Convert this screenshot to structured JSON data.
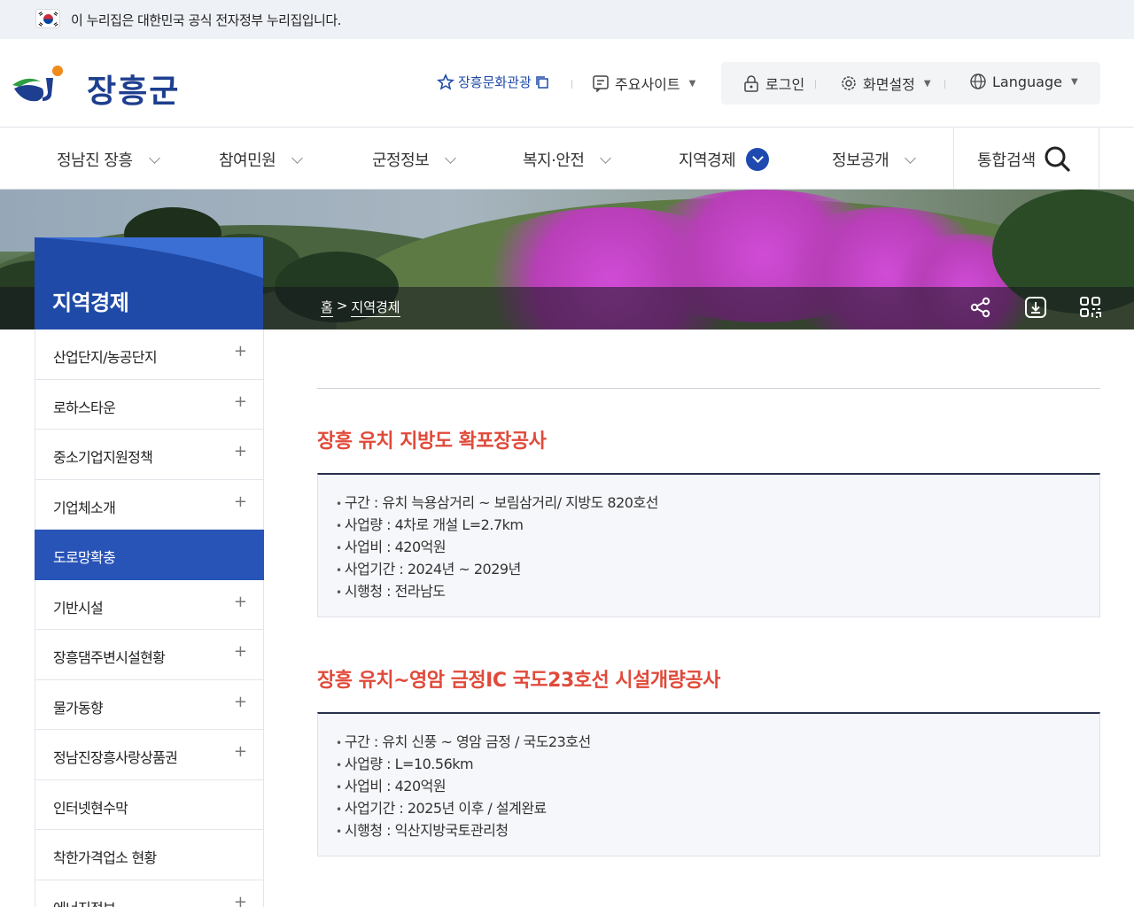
{
  "gov_banner": {
    "text": "이 누리집은 대한민국 공식 전자정부 누리집입니다."
  },
  "header": {
    "logo_text": "장흥군",
    "culture_link": "장흥문화관광",
    "main_sites": "주요사이트",
    "login": "로그인",
    "screen_settings": "화면설정",
    "language": "Language"
  },
  "gnb": {
    "items": [
      {
        "label": "정남진 장흥"
      },
      {
        "label": "참여민원"
      },
      {
        "label": "군정정보"
      },
      {
        "label": "복지·안전"
      },
      {
        "label": "지역경제"
      },
      {
        "label": "정보공개"
      }
    ],
    "search_label": "통합검색"
  },
  "visual": {
    "section_title": "지역경제",
    "breadcrumb_home": "홈",
    "breadcrumb_sep": ">",
    "breadcrumb_current": "지역경제"
  },
  "lnb": {
    "items": [
      {
        "label": "산업단지/농공단지",
        "plus": "+"
      },
      {
        "label": "로하스타운",
        "plus": "+"
      },
      {
        "label": "중소기업지원정책",
        "plus": "+"
      },
      {
        "label": "기업체소개",
        "plus": "+"
      },
      {
        "label": "도로망확충",
        "plus": ""
      },
      {
        "label": "기반시설",
        "plus": "+"
      },
      {
        "label": "장흥댐주변시설현황",
        "plus": "+"
      },
      {
        "label": "물가동향",
        "plus": "+"
      },
      {
        "label": "정남진장흥사랑상품권",
        "plus": "+"
      },
      {
        "label": "인터넷현수막",
        "plus": ""
      },
      {
        "label": "착한가격업소 현황",
        "plus": ""
      },
      {
        "label": "에너지정보",
        "plus": "+"
      }
    ]
  },
  "content": {
    "sections": [
      {
        "title": "장흥 유치 지방도 확포장공사",
        "rows": [
          "구간 : 유치 늑용삼거리 ~ 보림삼거리/ 지방도 820호선",
          "사업량 : 4차로 개설 L=2.7km",
          "사업비 : 420억원",
          "사업기간 : 2024년 ~ 2029년",
          "시행청 : 전라남도"
        ]
      },
      {
        "title": "장흥 유치~영암 금정IC 국도23호선 시설개량공사",
        "rows": [
          "구간 : 유치 신풍 ~ 영암 금정 / 국도23호선",
          "사업량 : L=10.56km",
          "사업비 : 420억원",
          "사업기간 : 2025년 이후 / 설계완료",
          "시행청 : 익산지방국토관리청"
        ]
      }
    ]
  },
  "colors": {
    "brand_blue": "#1f4aa8",
    "accent_red": "#e04a3a",
    "active_menu": "#2854b8"
  }
}
